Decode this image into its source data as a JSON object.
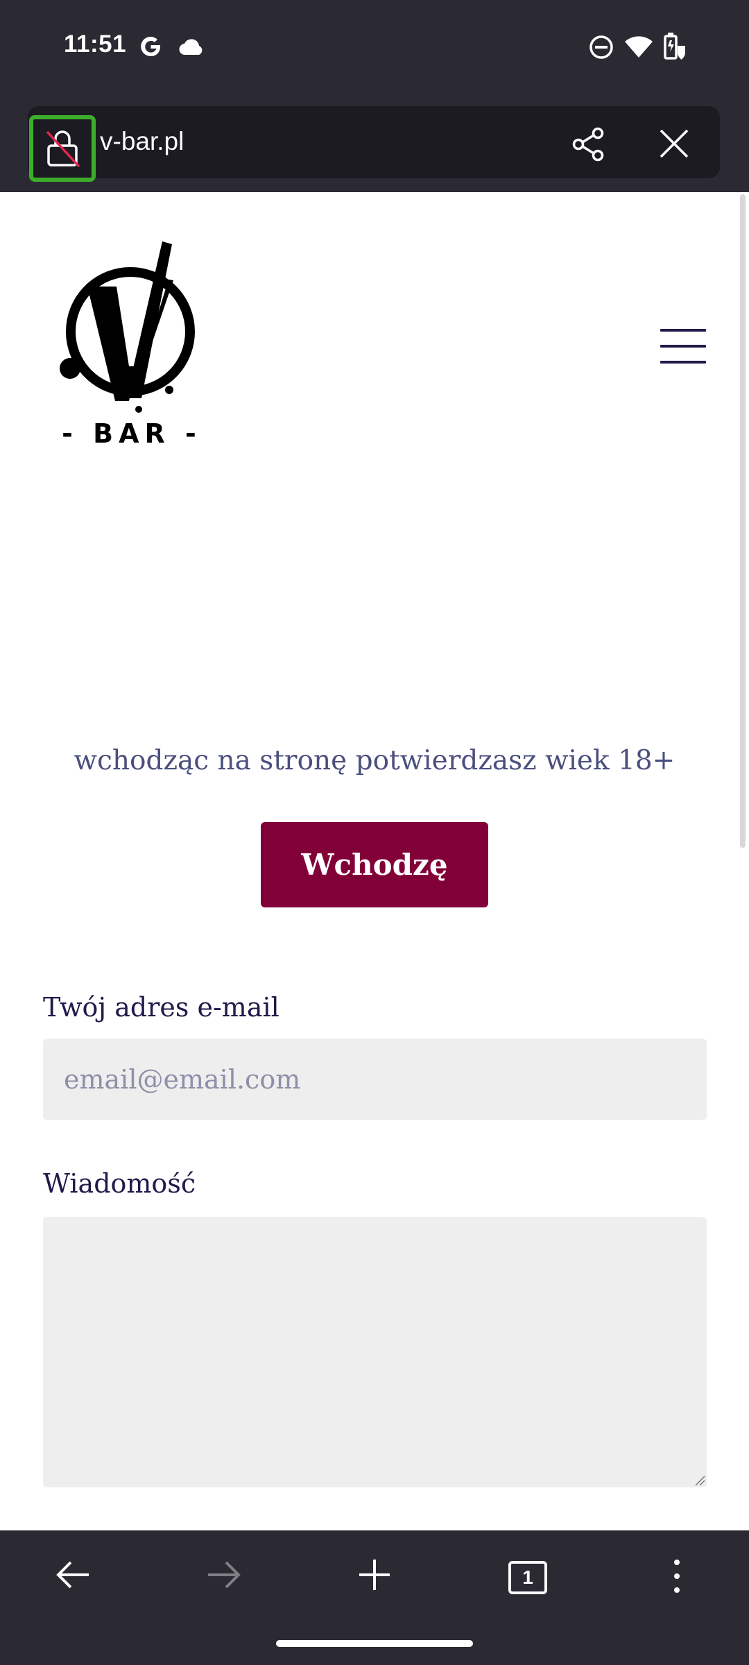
{
  "status_bar": {
    "time": "11:51",
    "left_icons": [
      "google-icon",
      "cloud-icon"
    ],
    "right_icons": [
      "do-not-disturb-icon",
      "wifi-icon",
      "battery-saver-icon"
    ]
  },
  "toolbar": {
    "url": "v-bar.pl",
    "lock_icon": "insecure-lock-icon",
    "share_icon": "share-icon",
    "close_icon": "close-icon",
    "highlight_color": "#3dae2b"
  },
  "site": {
    "logo_text": "- BAR -",
    "menu_icon": "hamburger-menu-icon",
    "age_notice": "wchodząc na stronę potwierdzasz wiek 18+",
    "enter_button": "Wchodzę",
    "email_label": "Twój adres e-mail",
    "email_placeholder": "email@email.com",
    "email_value": "",
    "message_label": "Wiadomość",
    "message_value": "",
    "accent_color": "#820038",
    "text_color": "#1f1a4b"
  },
  "bottom_nav": {
    "back_icon": "back-arrow-icon",
    "forward_icon": "forward-arrow-icon",
    "new_tab_icon": "plus-icon",
    "tab_count": "1",
    "menu_icon": "more-vertical-icon"
  }
}
